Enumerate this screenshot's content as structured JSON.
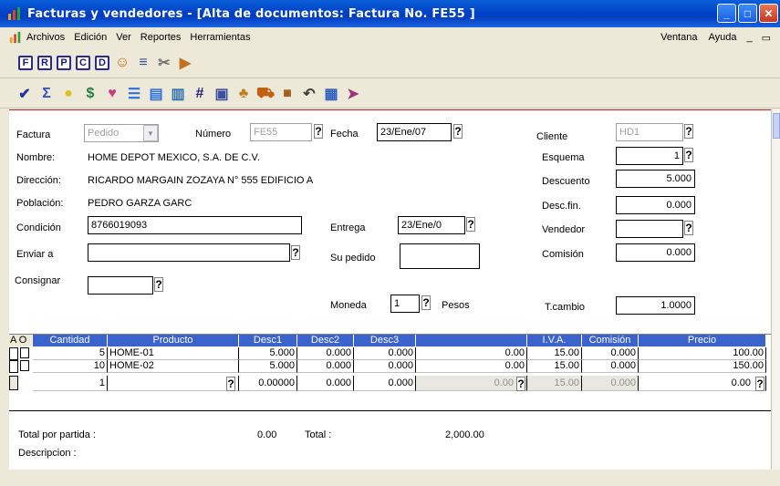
{
  "window": {
    "title": "Facturas y vendedores - [Alta de documentos: Factura No. FE55  ]"
  },
  "menu": {
    "items": [
      "Archivos",
      "Edición",
      "Ver",
      "Reportes",
      "Herramientas"
    ],
    "right": [
      "Ventana",
      "Ayuda"
    ]
  },
  "toolbar1": {
    "buttons": [
      "F",
      "R",
      "P",
      "C",
      "D"
    ]
  },
  "form": {
    "factura_label": "Factura",
    "factura_value": "Pedido",
    "numero_label": "Número",
    "numero_value": "FE55",
    "fecha_label": "Fecha",
    "fecha_value": "23/Ene/07",
    "cliente_label": "Cliente",
    "cliente_value": "HD1",
    "nombre_label": "Nombre:",
    "nombre_value": "HOME DEPOT MEXICO, S.A. DE C.V.",
    "esquema_label": "Esquema",
    "esquema_value": "1",
    "direccion_label": "Dirección:",
    "direccion_value": "RICARDO MARGAIN ZOZAYA N° 555 EDIFICIO A",
    "descuento_label": "Descuento",
    "descuento_value": "5.000",
    "poblacion_label": "Población:",
    "poblacion_value": "PEDRO GARZA GARC",
    "descfin_label": "Desc.fin.",
    "descfin_value": "0.000",
    "condicion_label": "Condición",
    "condicion_value": "8766019093",
    "entrega_label": "Entrega",
    "entrega_value": "23/Ene/0",
    "vendedor_label": "Vendedor",
    "vendedor_value": "",
    "enviar_label": "Enviar a",
    "enviar_value": "",
    "supedido_label": "Su pedido",
    "supedido_value": "",
    "comision_label": "Comisión",
    "comision_value": "0.000",
    "consignar_label": "Consignar",
    "consignar_value": "",
    "moneda_label": "Moneda",
    "moneda_value": "1",
    "moneda_name": "Pesos",
    "tcambio_label": "T.cambio",
    "tcambio_value": "1.0000",
    "help_mark": "?"
  },
  "grid": {
    "ao_label": "A O",
    "headers": [
      "Cantidad",
      "Producto",
      "Desc1",
      "Desc2",
      "Desc3",
      "",
      "I.V.A.",
      "Comisión",
      "Precio"
    ],
    "rows": [
      [
        "5",
        "HOME-01",
        "5.000",
        "0.000",
        "0.000",
        "0.00",
        "15.00",
        "0.000",
        "100.00"
      ],
      [
        "10",
        "HOME-02",
        "5.000",
        "0.000",
        "0.000",
        "0.00",
        "15.00",
        "0.000",
        "150.00"
      ],
      [
        "1",
        "",
        "0.00000",
        "0.000",
        "0.000",
        "0.00",
        "15.00",
        "0.000",
        "0.00"
      ]
    ]
  },
  "footer": {
    "total_partida_label": "Total por partida :",
    "total_partida_value": "0.00",
    "total_label": "Total  :",
    "total_value": "2,000.00",
    "descripcion_label": "Descripcion :"
  }
}
